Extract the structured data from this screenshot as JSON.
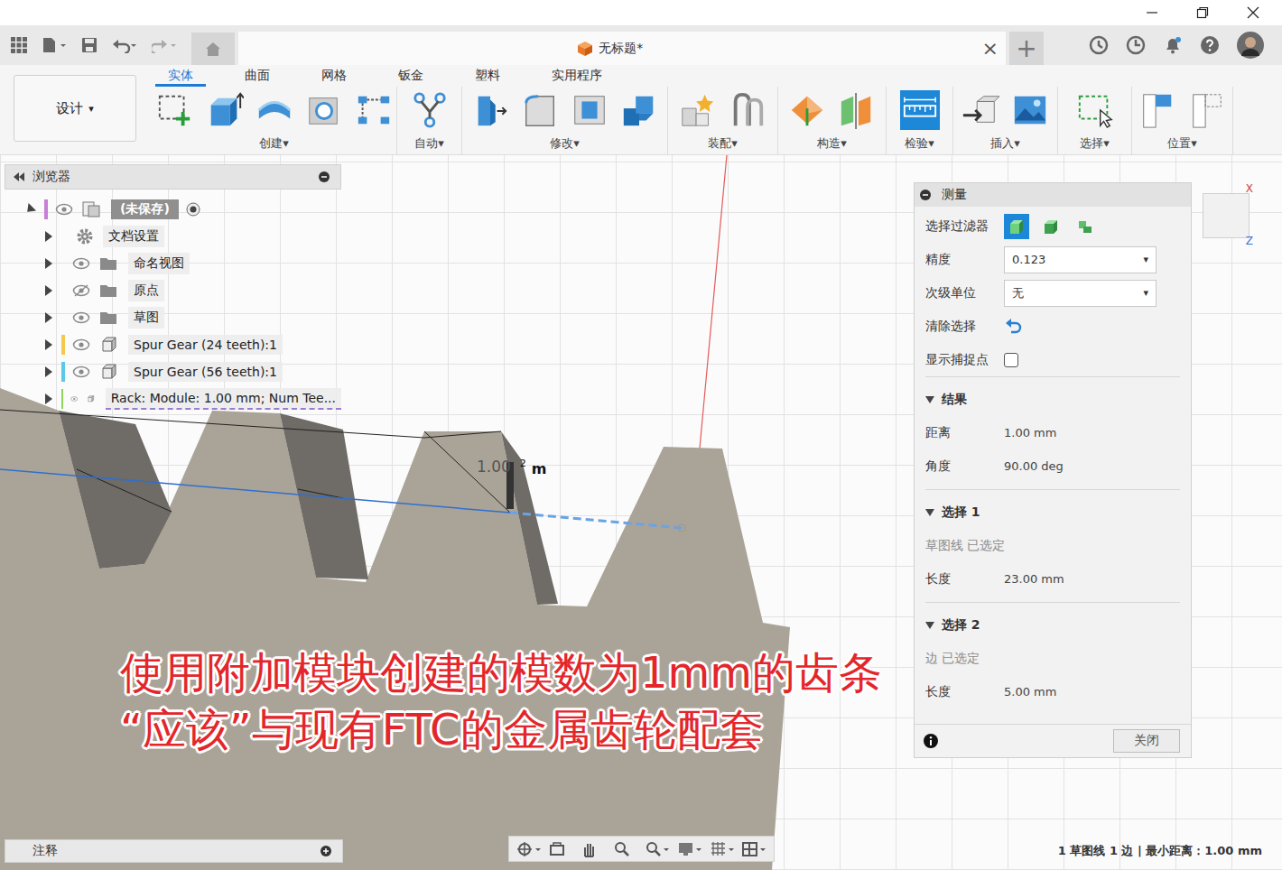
{
  "document_tab": {
    "title": "无标题*",
    "close": "×",
    "add": "+"
  },
  "design_button": {
    "label": "设计",
    "caret": "▾"
  },
  "ribbon_tabs": [
    {
      "label": "实体",
      "selected": true
    },
    {
      "label": "曲面",
      "selected": false
    },
    {
      "label": "网格",
      "selected": false
    },
    {
      "label": "钣金",
      "selected": false
    },
    {
      "label": "塑料",
      "selected": false
    },
    {
      "label": "实用程序",
      "selected": false
    }
  ],
  "tool_groups": [
    {
      "label": "创建▾",
      "active": false
    },
    {
      "label": "自动▾",
      "active": false
    },
    {
      "label": "修改▾",
      "active": false
    },
    {
      "label": "装配▾",
      "active": false
    },
    {
      "label": "构造▾",
      "active": false
    },
    {
      "label": "检验▾",
      "active": true
    },
    {
      "label": "插入▾",
      "active": false
    },
    {
      "label": "选择▾",
      "active": false
    },
    {
      "label": "位置▾",
      "active": false
    }
  ],
  "browser": {
    "title": "浏览器",
    "root": {
      "label": "(未保存)",
      "expanded": true,
      "visible": true,
      "color": "#c77fd6"
    },
    "items": [
      {
        "label": "文档设置",
        "kind": "settings",
        "expanded": false,
        "selected": false
      },
      {
        "label": "命名视图",
        "kind": "folder",
        "expanded": false,
        "visible": true,
        "selected": false
      },
      {
        "label": "原点",
        "kind": "folder",
        "expanded": false,
        "visible": false,
        "selected": false
      },
      {
        "label": "草图",
        "kind": "folder",
        "expanded": false,
        "visible": true,
        "selected": false
      },
      {
        "label": "Spur Gear (24 teeth):1",
        "kind": "component",
        "expanded": false,
        "visible": true,
        "selected": false,
        "color": "#f2c94c"
      },
      {
        "label": "Spur Gear (56 teeth):1",
        "kind": "component",
        "expanded": false,
        "visible": true,
        "selected": false,
        "color": "#5cc8e8"
      },
      {
        "label": "Rack: Module: 1.00 mm; Num Tee...",
        "kind": "component",
        "expanded": false,
        "visible": true,
        "selected": true,
        "color": "#8fd35c"
      }
    ]
  },
  "measure": {
    "title": "测量",
    "filter_label": "选择过滤器",
    "filters": [
      {
        "kind": "body",
        "selected": true
      },
      {
        "kind": "face",
        "selected": false
      },
      {
        "kind": "component",
        "selected": false
      }
    ],
    "fields": [
      {
        "label": "精度",
        "value": "0.123",
        "caret": "▾"
      },
      {
        "label": "次级单位",
        "value": "无",
        "caret": "▾"
      }
    ],
    "clear_label": "清除选择",
    "snap": {
      "label": "显示捕捉点",
      "checked": false
    },
    "sections": [
      {
        "title": "结果",
        "expanded": true,
        "rows": [
          {
            "label": "距离",
            "value": "1.00 mm"
          },
          {
            "label": "角度",
            "value": "90.00 deg"
          }
        ]
      },
      {
        "title": "选择 1",
        "expanded": true,
        "note": "草图线 已选定",
        "rows": [
          {
            "label": "长度",
            "value": "23.00 mm"
          }
        ]
      },
      {
        "title": "选择 2",
        "expanded": true,
        "note": "边 已选定",
        "rows": [
          {
            "label": "长度",
            "value": "5.00 mm"
          }
        ]
      }
    ],
    "close": "关闭"
  },
  "viewcube": {
    "x": "X",
    "z": "Z"
  },
  "dimension": {
    "value": "1.00",
    "index": "2",
    "unit": "m"
  },
  "caption": [
    "使用附加模块创建的模数为1mm的齿条",
    "“应该”与现有FTC的金属齿轮配套"
  ],
  "annotations": {
    "label": "注释"
  },
  "status": "1 草图线 1 边 | 最小距离：1.00 mm"
}
